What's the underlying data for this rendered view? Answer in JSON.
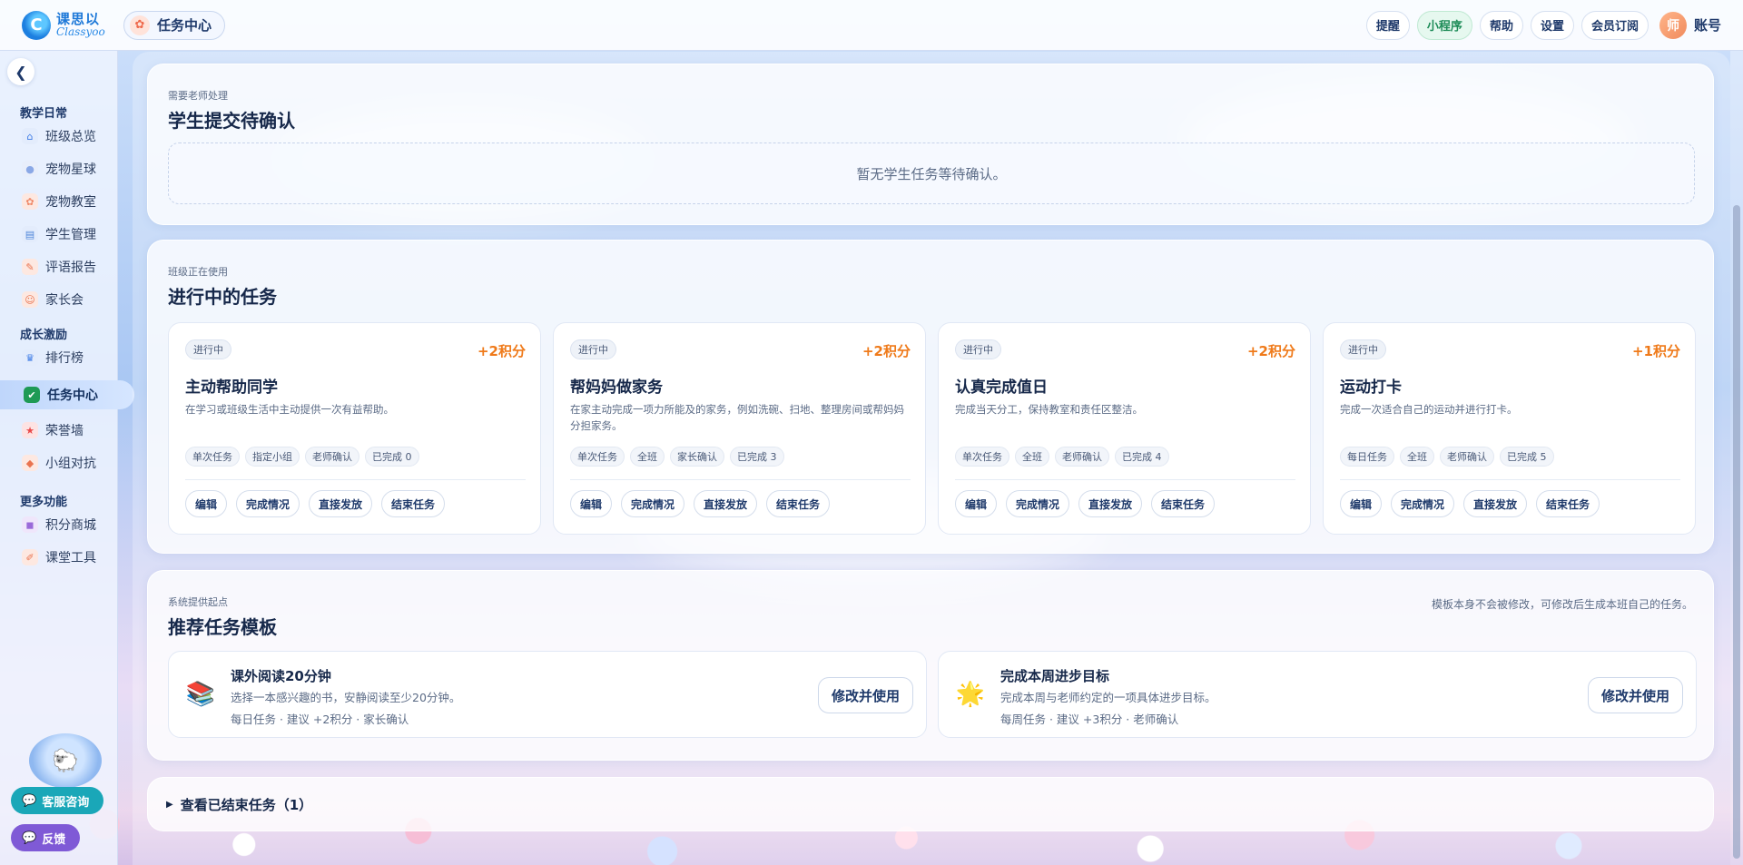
{
  "brand": {
    "logo_cn": "课思以",
    "logo_en": "Classyoo",
    "logo_mark": "C"
  },
  "page_chip": {
    "label": "任务中心",
    "icon": "paw-icon"
  },
  "top_actions": [
    {
      "label": "提醒",
      "style": "default"
    },
    {
      "label": "小程序",
      "style": "green"
    },
    {
      "label": "帮助",
      "style": "default"
    },
    {
      "label": "设置",
      "style": "default"
    },
    {
      "label": "会员订阅",
      "style": "default"
    }
  ],
  "account": {
    "avatar": "师",
    "label": "账号"
  },
  "sidebar": {
    "collapse_glyph": "❮",
    "groups": [
      {
        "title": "教学日常",
        "items": [
          {
            "label": "班级总览",
            "icon": "house-icon",
            "glyph": "⌂",
            "color": "#3d7be6"
          },
          {
            "label": "宠物星球",
            "icon": "planet-icon",
            "glyph": "●",
            "color": "#8aa8e6"
          },
          {
            "label": "宠物教室",
            "icon": "paw-icon",
            "glyph": "✿",
            "color": "#ef8a6a"
          },
          {
            "label": "学生管理",
            "icon": "student-icon",
            "glyph": "▤",
            "color": "#4f86d9"
          },
          {
            "label": "评语报告",
            "icon": "report-icon",
            "glyph": "✎",
            "color": "#e9734f"
          },
          {
            "label": "家长会",
            "icon": "family-icon",
            "glyph": "☺",
            "color": "#e9734f"
          }
        ]
      },
      {
        "title": "成长激励",
        "items": [
          {
            "label": "排行榜",
            "icon": "trophy-icon",
            "glyph": "♛",
            "color": "#3d7be6"
          },
          {
            "label": "任务中心",
            "icon": "checklist-icon",
            "glyph": "✔",
            "color": "#1f9a55",
            "active": true
          },
          {
            "label": "荣誉墙",
            "icon": "star-icon",
            "glyph": "★",
            "color": "#e94a4a"
          },
          {
            "label": "小组对抗",
            "icon": "shield-icon",
            "glyph": "◆",
            "color": "#e9734f"
          }
        ]
      },
      {
        "title": "更多功能",
        "items": [
          {
            "label": "积分商城",
            "icon": "shop-icon",
            "glyph": "◼",
            "color": "#9a6ad9"
          },
          {
            "label": "课堂工具",
            "icon": "tool-icon",
            "glyph": "✐",
            "color": "#e9734f"
          }
        ]
      }
    ]
  },
  "float_buttons": {
    "cs_label": "客服咨询",
    "feedback_label": "反馈"
  },
  "pending": {
    "sub": "需要老师处理",
    "title": "学生提交待确认",
    "empty_text": "暂无学生任务等待确认。"
  },
  "active": {
    "sub": "班级正在使用",
    "title": "进行中的任务",
    "tasks": [
      {
        "status": "进行中",
        "points": "+2积分",
        "title": "主动帮助同学",
        "desc": "在学习或班级生活中主动提供一次有益帮助。",
        "tags": [
          "单次任务",
          "指定小组",
          "老师确认",
          "已完成 0"
        ]
      },
      {
        "status": "进行中",
        "points": "+2积分",
        "title": "帮妈妈做家务",
        "desc": "在家主动完成一项力所能及的家务，例如洗碗、扫地、整理房间或帮妈妈分担家务。",
        "tags": [
          "单次任务",
          "全班",
          "家长确认",
          "已完成 3"
        ]
      },
      {
        "status": "进行中",
        "points": "+2积分",
        "title": "认真完成值日",
        "desc": "完成当天分工，保持教室和责任区整洁。",
        "tags": [
          "单次任务",
          "全班",
          "老师确认",
          "已完成 4"
        ]
      },
      {
        "status": "进行中",
        "points": "+1积分",
        "title": "运动打卡",
        "desc": "完成一次适合自己的运动并进行打卡。",
        "tags": [
          "每日任务",
          "全班",
          "老师确认",
          "已完成 5"
        ]
      }
    ],
    "actions": [
      "编辑",
      "完成情况",
      "直接发放",
      "结束任务"
    ]
  },
  "templates": {
    "sub": "系统提供起点",
    "title": "推荐任务模板",
    "note": "模板本身不会被修改，可修改后生成本班自己的任务。",
    "items": [
      {
        "icon": "books-icon",
        "glyph": "📚",
        "title": "课外阅读20分钟",
        "desc": "选择一本感兴趣的书，安静阅读至少20分钟。",
        "meta": "每日任务 · 建议 +2积分 · 家长确认"
      },
      {
        "icon": "sparkle-star-icon",
        "glyph": "🌟",
        "title": "完成本周进步目标",
        "desc": "完成本周与老师约定的一项具体进步目标。",
        "meta": "每周任务 · 建议 +3积分 · 老师确认"
      }
    ],
    "use_label": "修改并使用"
  },
  "ended": {
    "label": "查看已结束任务（1）",
    "glyph": "▶"
  }
}
